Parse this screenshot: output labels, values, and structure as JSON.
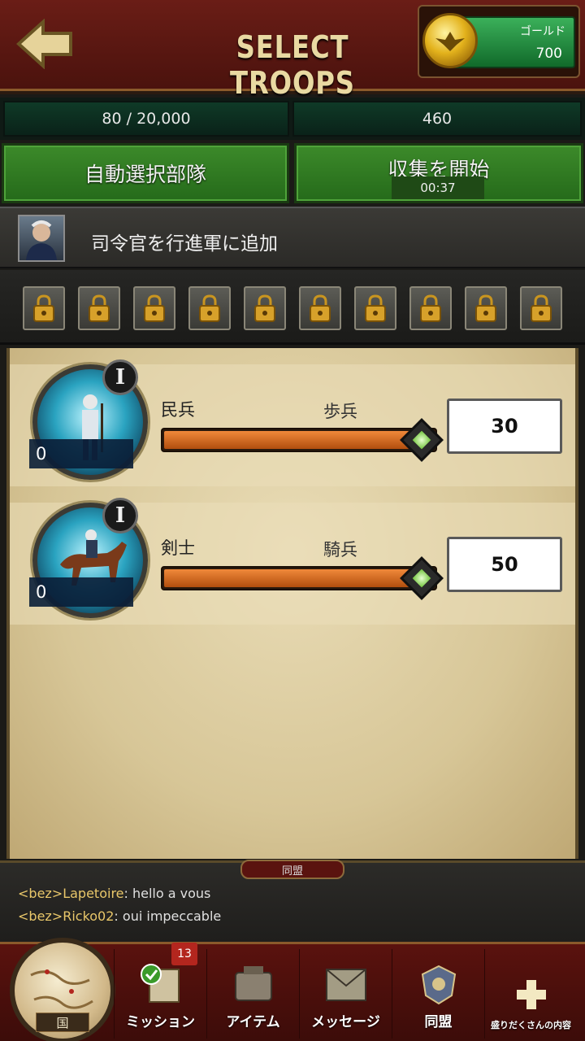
{
  "header": {
    "title": "SELECT TROOPS",
    "back_icon": "arrow-left-icon",
    "currency": {
      "label": "ゴールド",
      "value": "700",
      "icon": "gold-coin-icon"
    }
  },
  "stats": {
    "capacity": "80 / 20,000",
    "power": "460"
  },
  "actions": {
    "auto_select": "自動選択部隊",
    "start_gather": "収集を開始",
    "timer": "00:37"
  },
  "commander": {
    "label": "司令官を行進軍に追加"
  },
  "locked_slots": 10,
  "troops": [
    {
      "name": "民兵",
      "type": "歩兵",
      "rank": "I",
      "owned": "0",
      "quantity": "30",
      "slider_fraction": 0.95
    },
    {
      "name": "剣士",
      "type": "騎兵",
      "rank": "I",
      "owned": "0",
      "quantity": "50",
      "slider_fraction": 0.95
    }
  ],
  "chat": {
    "tab_label": "同盟",
    "messages": [
      {
        "sender": "<bez>Lapetoire",
        "text": "hello a vous"
      },
      {
        "sender": "<bez>Ricko02",
        "text": "oui impeccable"
      }
    ]
  },
  "nav": {
    "kingdom_label": "国",
    "items": [
      {
        "label": "ミッション",
        "badge": "13",
        "icon": "mission-scroll-icon"
      },
      {
        "label": "アイテム",
        "icon": "item-bag-icon"
      },
      {
        "label": "メッセージ",
        "icon": "mail-icon"
      },
      {
        "label": "同盟",
        "icon": "alliance-crest-icon"
      },
      {
        "label": "盛りだくさんの内容",
        "icon": "plus-icon"
      }
    ]
  },
  "colors": {
    "accent_green": "#3c8a2a",
    "header_red": "#6a1d16",
    "slider_orange": "#e07a2c",
    "gold": "#e3b21c"
  }
}
